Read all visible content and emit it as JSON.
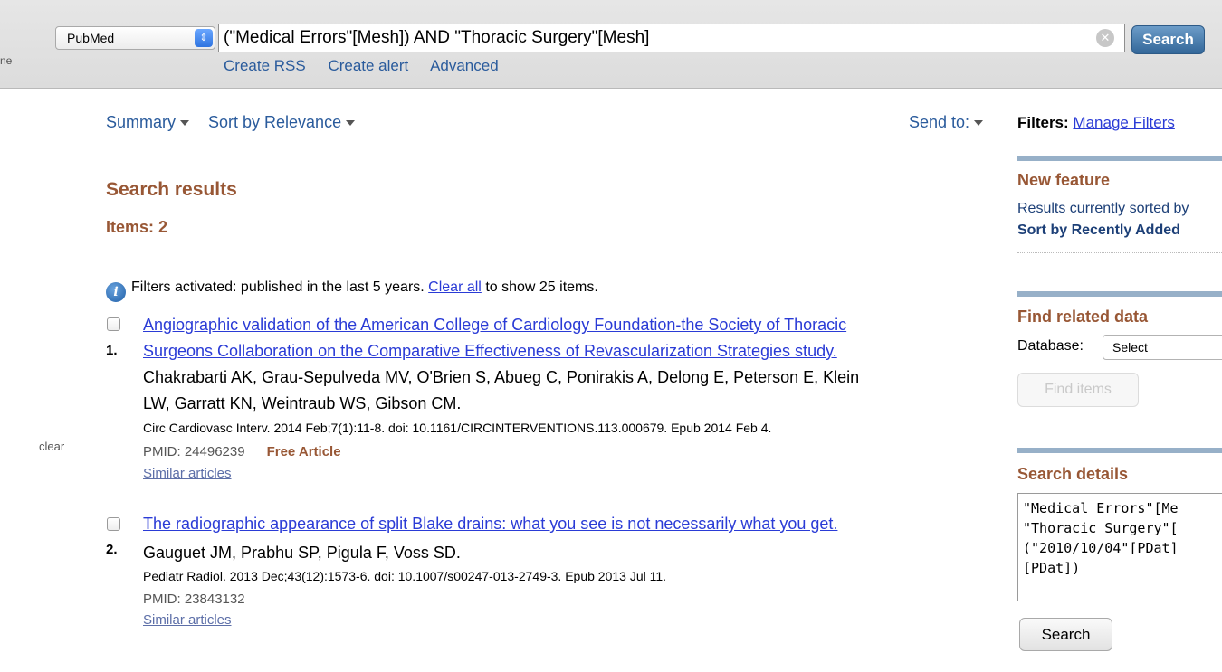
{
  "header": {
    "left_edge_text": "ne",
    "database": "PubMed",
    "search_term": "(\"Medical Errors\"[Mesh]) AND \"Thoracic Surgery\"[Mesh]",
    "search_button": "Search",
    "links": [
      "Create RSS",
      "Create alert",
      "Advanced"
    ]
  },
  "toolbar": {
    "format": "Summary",
    "sort": "Sort by Relevance",
    "send_to": "Send to:"
  },
  "results": {
    "title": "Search results",
    "items": "Items: 2",
    "filter_note_pre": "Filters activated: published in the last 5 years.",
    "filter_clear_link": "Clear all",
    "filter_note_post": "to show 25 items.",
    "side_clear": "clear",
    "list": [
      {
        "number": "1.",
        "title_line1": "Angiographic validation of the American College of Cardiology Foundation-the Society of Thoracic",
        "title_line2": "Surgeons Collaboration on the Comparative Effectiveness of Revascularization Strategies study.",
        "authors_line1": "Chakrabarti AK, Grau-Sepulveda MV, O'Brien S, Abueg C, Ponirakis A, Delong E, Peterson E, Klein",
        "authors_line2": "LW, Garratt KN, Weintraub WS, Gibson CM.",
        "journal": "Circ Cardiovasc Interv. 2014 Feb;7(1):11-8. doi: 10.1161/CIRCINTERVENTIONS.113.000679. Epub 2014 Feb 4.",
        "pmid": "PMID: 24496239",
        "free": "Free Article",
        "similar": "Similar articles"
      },
      {
        "number": "2.",
        "title_line1": "The radiographic appearance of split Blake drains: what you see is not necessarily what you get.",
        "authors_line1": "Gauguet JM, Prabhu SP, Pigula F, Voss SD.",
        "journal": "Pediatr Radiol. 2013 Dec;43(12):1573-6. doi: 10.1007/s00247-013-2749-3. Epub 2013 Jul 11.",
        "pmid": "PMID: 23843132",
        "similar": "Similar articles"
      }
    ]
  },
  "sidebar": {
    "filters_label": "Filters:",
    "manage_filters": "Manage Filters",
    "new_feature": {
      "title": "New feature",
      "text": "Results currently sorted by",
      "link": "Sort by Recently Added"
    },
    "related": {
      "title": "Find related data",
      "db_label": "Database:",
      "db_value": "Select",
      "button": "Find items"
    },
    "details": {
      "title": "Search details",
      "query": "\"Medical Errors\"[Me\n\"Thoracic Surgery\"[\n(\"2010/10/04\"[PDat]\n[PDat])",
      "button": "Search"
    }
  }
}
